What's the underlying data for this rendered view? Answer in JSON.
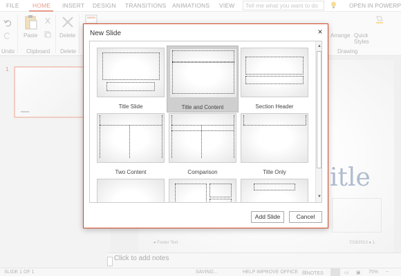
{
  "ribbon": {
    "tabs": [
      "FILE",
      "HOME",
      "INSERT",
      "DESIGN",
      "TRANSITIONS",
      "ANIMATIONS",
      "VIEW"
    ],
    "active_tab": "HOME",
    "tell_me_placeholder": "Tell me what you want to do",
    "open_in_label": "OPEN IN POWERPOINT",
    "undo_label": "Undo",
    "paste_label": "Paste",
    "delete_label": "Delete",
    "arrange_label": "Arrange",
    "quick_styles_label": "Quick Styles",
    "groups": {
      "undo": "Undo",
      "clipboard": "Clipboard",
      "delete": "Delete",
      "drawing": "Drawing"
    }
  },
  "thumbnails": {
    "slide_number": "1"
  },
  "slide": {
    "title_partial": "itle",
    "footer_text": "Footer Text",
    "date_text": "7/19/2013",
    "page_marker": "1"
  },
  "notes": {
    "placeholder": "Click to add notes"
  },
  "status": {
    "slide_counter": "SLIDE 1 OF 1",
    "saving": "SAVING...",
    "help_improve": "HELP IMPROVE OFFICE",
    "notes_label": "NOTES",
    "zoom": "75%"
  },
  "dialog": {
    "title": "New Slide",
    "close_glyph": "×",
    "layouts": [
      "Title Slide",
      "Title and Content",
      "Section Header",
      "Two Content",
      "Comparison",
      "Title Only",
      "",
      "",
      ""
    ],
    "selected_layout": "Title and Content",
    "add_button": "Add Slide",
    "cancel_button": "Cancel"
  },
  "colors": {
    "accent": "#d24726",
    "title_blue": "#6d86a8"
  }
}
